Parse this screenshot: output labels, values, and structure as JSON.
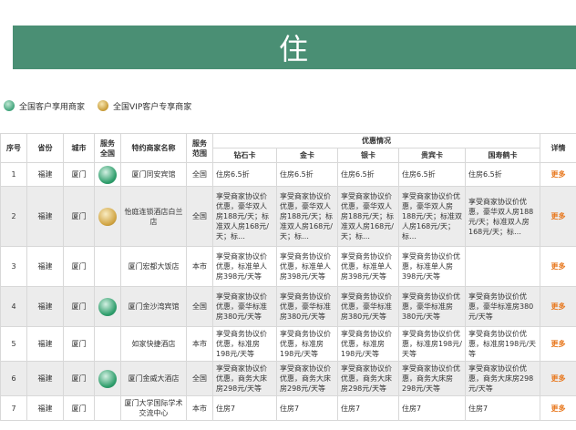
{
  "banner": {
    "title": "住"
  },
  "legend": [
    {
      "label": "全国客户享用商家",
      "icon": "green-badge-icon"
    },
    {
      "label": "全国VIP客户专享商家",
      "icon": "gold-badge-icon"
    }
  ],
  "table": {
    "headers": {
      "no": "序号",
      "province": "省份",
      "city": "城市",
      "service": "服务全国",
      "merchant": "特约商家名称",
      "scope": "服务范围",
      "discount": "优惠情况",
      "diamond": "钻石卡",
      "gold": "金卡",
      "silver": "银卡",
      "guest": "贵宾卡",
      "longevity": "国寿鹤卡",
      "detail": "详情"
    },
    "rows": [
      {
        "no": "1",
        "province": "福建",
        "city": "厦门",
        "badge": "green",
        "merchant": "厦门同安宾馆",
        "scope": "全国",
        "diamond": "住房6.5折",
        "gold": "住房6.5折",
        "silver": "住房6.5折",
        "guest": "住房6.5折",
        "longevity": "住房6.5折",
        "more": "更多"
      },
      {
        "no": "2",
        "province": "福建",
        "city": "厦门",
        "badge": "gold",
        "merchant": "怡庭连锁酒店白兰店",
        "scope": "全国",
        "diamond": "享受商家协议价优惠，豪华双人房188元/天；标准双人房168元/天；标…",
        "gold": "享受商家协议价优惠，豪华双人房188元/天；标准双人房168元/天；标…",
        "silver": "享受商家协议价优惠，豪华双人房188元/天；标准双人房168元/天；标…",
        "guest": "享受商家协议价优惠，豪华双人房188元/天；标准双人房168元/天；标…",
        "longevity": "享受商家协议价优惠，豪华双人房188元/天；标准双人房168元/天；标…",
        "more": "更多"
      },
      {
        "no": "3",
        "province": "福建",
        "city": "厦门",
        "badge": "",
        "merchant": "厦门宏都大饭店",
        "scope": "本市",
        "diamond": "享受商家协议价优惠，标准单人房398元/天等",
        "gold": "享受商务协议价优惠，标准单人房398元/天等",
        "silver": "享受商务协议价优惠，标准单人房398元/天等",
        "guest": "享受商务协议价优惠，标准单人房398元/天等",
        "longevity": "",
        "more": "更多"
      },
      {
        "no": "4",
        "province": "福建",
        "city": "厦门",
        "badge": "green",
        "merchant": "厦门金沙湾宾馆",
        "scope": "全国",
        "diamond": "享受商家协议价优惠，豪华标准房380元/天等",
        "gold": "享受商务协议价优惠，豪华标准房380元/天等",
        "silver": "享受商务协议价优惠，豪华标准房380元/天等",
        "guest": "享受商务协议价优惠，豪华标准房380元/天等",
        "longevity": "享受商务协议价优惠，豪华标准房380元/天等",
        "more": "更多"
      },
      {
        "no": "5",
        "province": "福建",
        "city": "厦门",
        "badge": "",
        "merchant": "如家快捷酒店",
        "scope": "本市",
        "diamond": "享受商务协议价优惠，标准房198元/天等",
        "gold": "享受商务协议价优惠，标准房198元/天等",
        "silver": "享受商务协议价优惠，标准房198元/天等",
        "guest": "享受商务协议价优惠，标准房198元/天等",
        "longevity": "享受商务协议价优惠，标准房198元/天等",
        "more": "更多"
      },
      {
        "no": "6",
        "province": "福建",
        "city": "厦门",
        "badge": "green",
        "merchant": "厦门金威大酒店",
        "scope": "全国",
        "diamond": "享受商家协议价优惠，商务大床房298元/天等",
        "gold": "享受商家协议价优惠，商务大床房298元/天等",
        "silver": "享受商家协议价优惠，商务大床房298元/天等",
        "guest": "享受商家协议价优惠，商务大床房298元/天等",
        "longevity": "享受商家协议价优惠，商务大床房298元/天等",
        "more": "更多"
      },
      {
        "no": "7",
        "province": "福建",
        "city": "厦门",
        "badge": "",
        "merchant": "厦门大学国际学术交流中心",
        "scope": "本市",
        "diamond": "住房7",
        "gold": "住房7",
        "silver": "住房7",
        "guest": "住房7",
        "longevity": "住房7",
        "more": "更多"
      }
    ]
  }
}
